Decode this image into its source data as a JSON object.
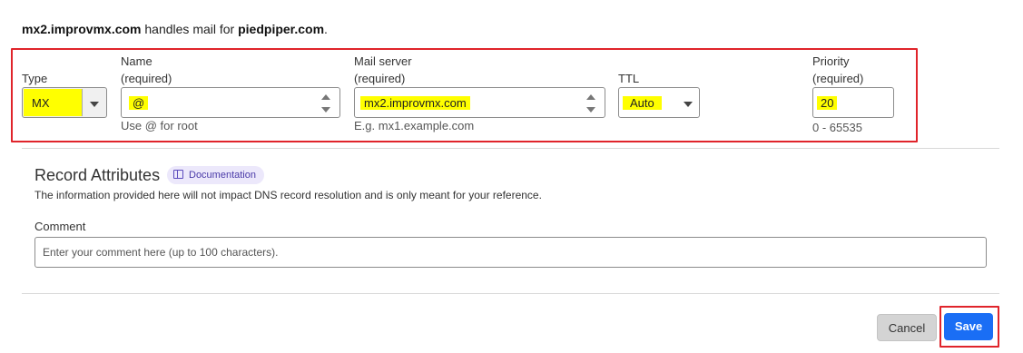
{
  "summary": {
    "server": "mx2.improvmx.com",
    "middle": " handles mail for ",
    "domain": "piedpiper.com",
    "end": "."
  },
  "record": {
    "type": {
      "label": "Type",
      "value": "MX"
    },
    "name": {
      "label": "Name",
      "required": "(required)",
      "value": "@",
      "help": "Use @ for root"
    },
    "mail_server": {
      "label": "Mail server",
      "required": "(required)",
      "value": "mx2.improvmx.com",
      "help": "E.g. mx1.example.com"
    },
    "ttl": {
      "label": "TTL",
      "value": "Auto"
    },
    "priority": {
      "label": "Priority",
      "required": "(required)",
      "value": "20",
      "help": "0 - 65535"
    }
  },
  "attributes": {
    "title": "Record Attributes",
    "doc_label": "Documentation",
    "description": "The information provided here will not impact DNS record resolution and is only meant for your reference.",
    "comment_label": "Comment",
    "comment_placeholder": "Enter your comment here (up to 100 characters)."
  },
  "actions": {
    "cancel_label": "Cancel",
    "save_label": "Save"
  },
  "colors": {
    "highlight": "#ffff00",
    "annotation_red": "#e0242b",
    "save_blue": "#1a6ef5",
    "doc_pill": "#ece8fb"
  },
  "icons": [
    "book-icon",
    "chevron-down-icon",
    "spinner-up-icon",
    "spinner-down-icon"
  ]
}
